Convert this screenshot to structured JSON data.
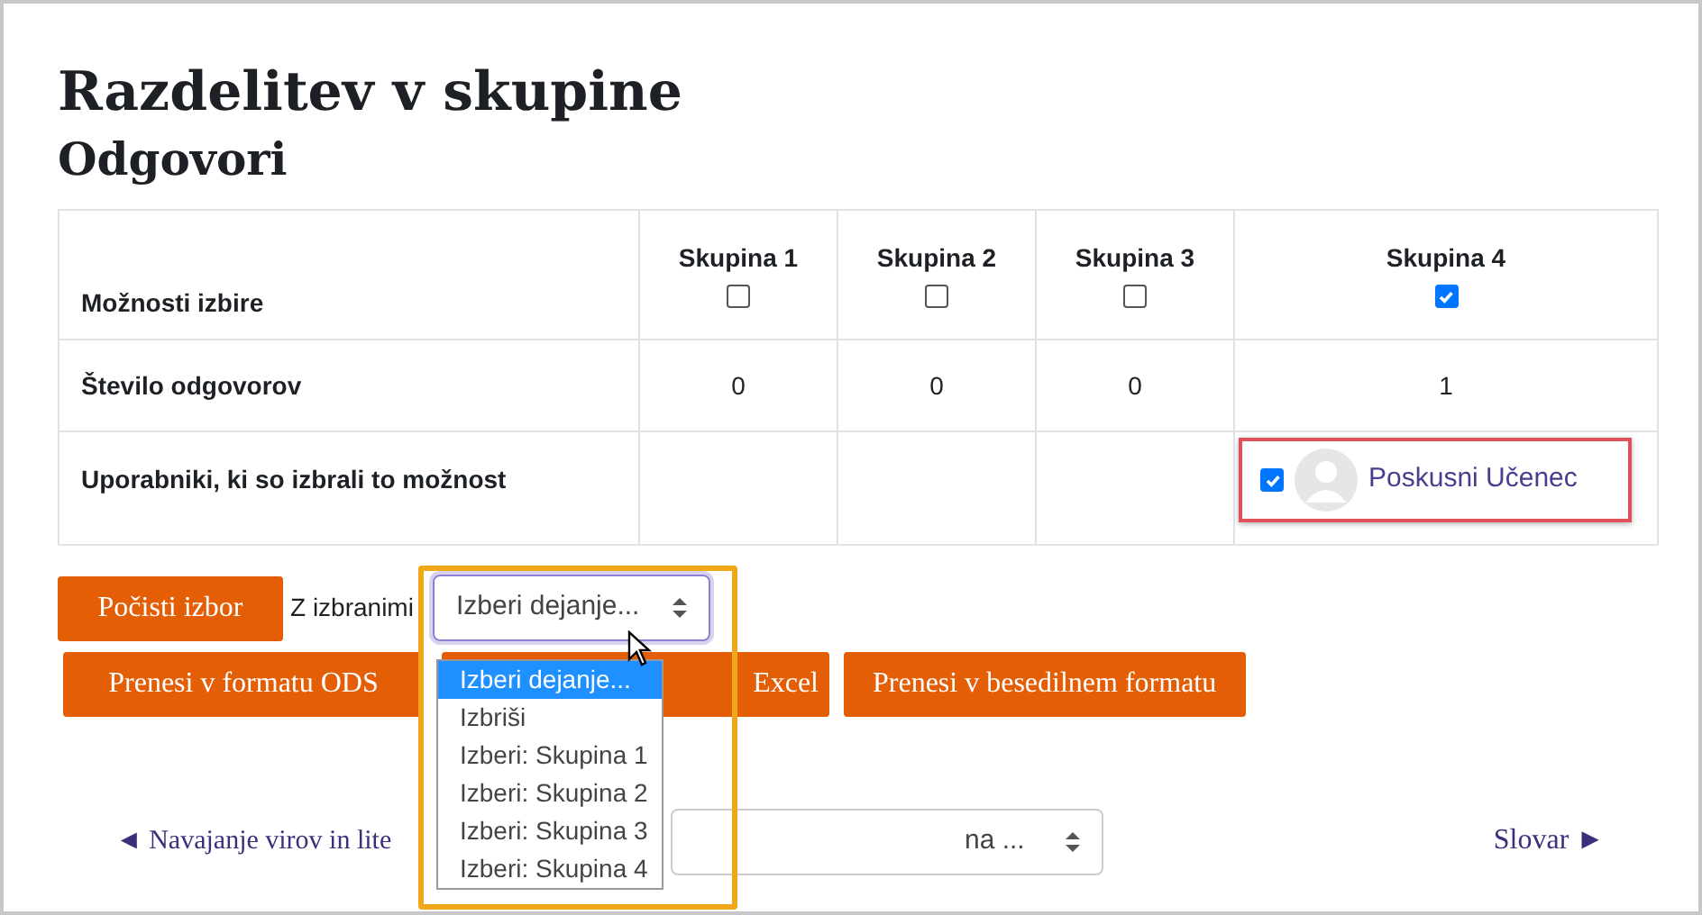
{
  "title": "Razdelitev v skupine",
  "subtitle": "Odgovori",
  "table": {
    "row_header": "Možnosti izbire",
    "columns": [
      {
        "label": "Skupina 1",
        "checked": false
      },
      {
        "label": "Skupina 2",
        "checked": false
      },
      {
        "label": "Skupina 3",
        "checked": false
      },
      {
        "label": "Skupina 4",
        "checked": true,
        "users": [
          {
            "name": "Poskusni Učenec",
            "checked": true,
            "highlighted": true
          }
        ]
      }
    ],
    "count_label": "Število odgovorov",
    "counts": [
      "0",
      "0",
      "0",
      "1"
    ],
    "users_label": "Uporabniki, ki so izbrali to možnost"
  },
  "clear_button": "Počisti izbor",
  "with_selected": "Z izbranimi",
  "action_select": {
    "value": "Izberi dejanje...",
    "expanded": true,
    "highlighted": true,
    "options": [
      {
        "label": "Izberi dejanje...",
        "selected": true
      },
      {
        "label": "Izbriši",
        "selected": false
      },
      {
        "label": "Izberi: Skupina 1",
        "selected": false
      },
      {
        "label": "Izberi: Skupina 2",
        "selected": false
      },
      {
        "label": "Izberi: Skupina 3",
        "selected": false
      },
      {
        "label": "Izberi: Skupina 4",
        "selected": false
      }
    ]
  },
  "export_buttons": [
    "Prenesi v formatu ODS",
    "Excel",
    "Prenesi v besedilnem formatu"
  ],
  "nav": {
    "previous": "◄ Navajanje virov in lite",
    "jump_value": "na ...",
    "next": "Slovar ►"
  }
}
